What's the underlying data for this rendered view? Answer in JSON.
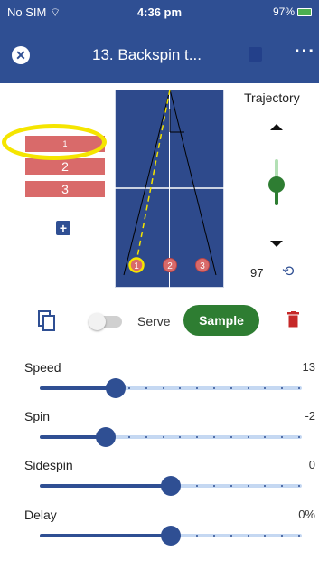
{
  "status": {
    "carrier": "No SIM",
    "time": "4:36 pm",
    "battery": "97%"
  },
  "header": {
    "title": "13. Backspin t..."
  },
  "sequence": {
    "items": [
      "1",
      "2",
      "3"
    ]
  },
  "court": {
    "markers": [
      "1",
      "2",
      "3"
    ]
  },
  "trajectory": {
    "label": "Trajectory",
    "value": "97",
    "level": 0.45
  },
  "actions": {
    "serve_label": "Serve",
    "sample_label": "Sample"
  },
  "sliders": [
    {
      "label": "Speed",
      "value": "13",
      "fraction": 0.29
    },
    {
      "label": "Spin",
      "value": "-2",
      "fraction": 0.25
    },
    {
      "label": "Sidespin",
      "value": "0",
      "fraction": 0.5
    },
    {
      "label": "Delay",
      "value": "0%",
      "fraction": 0.5
    }
  ],
  "colors": {
    "primary": "#2f4f93",
    "green": "#2e7d32",
    "sequence_red": "#d96a6a",
    "highlight": "#f5e500",
    "court": "#2e4a8c"
  }
}
